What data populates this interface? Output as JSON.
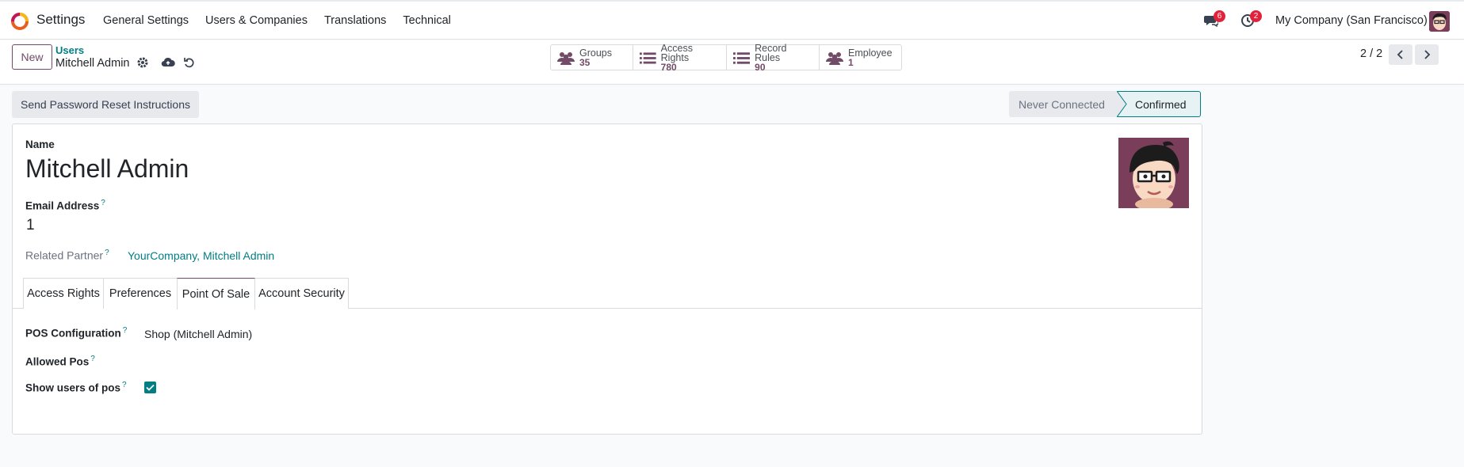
{
  "navbar": {
    "app_name": "Settings",
    "menu": [
      "General Settings",
      "Users & Companies",
      "Translations",
      "Technical"
    ],
    "messages_count": "6",
    "activities_count": "2",
    "company": "My Company (San Francisco)"
  },
  "control": {
    "new_label": "New",
    "breadcrumb_parent": "Users",
    "breadcrumb_current": "Mitchell Admin",
    "smart_buttons": [
      {
        "label": "Groups",
        "value": "35"
      },
      {
        "label": "Access Rights",
        "value": "780"
      },
      {
        "label": "Record Rules",
        "value": "90"
      },
      {
        "label": "Employee",
        "value": "1"
      }
    ],
    "pager": "2 / 2"
  },
  "statusbar": {
    "reset_button": "Send Password Reset Instructions",
    "stages": [
      "Never Connected",
      "Confirmed"
    ],
    "active_stage": "Confirmed"
  },
  "form": {
    "name_label": "Name",
    "name_value": "Mitchell Admin",
    "email_label": "Email Address",
    "email_value": "1",
    "partner_label": "Related Partner",
    "partner_value": "YourCompany, Mitchell Admin",
    "help_mark": "?",
    "tabs": [
      "Access Rights",
      "Preferences",
      "Point Of Sale",
      "Account Security"
    ],
    "active_tab": "Point Of Sale",
    "pos_config_label": "POS Configuration",
    "pos_config_value": "Shop (Mitchell Admin)",
    "allowed_pos_label": "Allowed Pos",
    "show_users_label": "Show users of pos",
    "show_users_checked": true
  },
  "colors": {
    "primary": "#714b67",
    "accent": "#017e84",
    "badge": "#e2223a"
  },
  "icons": [
    "odoo-logo-icon",
    "chat-icon",
    "clock-icon",
    "gear-icon",
    "cloud-upload-icon",
    "undo-icon",
    "users-icon",
    "list-icon",
    "chevron-left-icon",
    "chevron-right-icon",
    "check-icon"
  ]
}
